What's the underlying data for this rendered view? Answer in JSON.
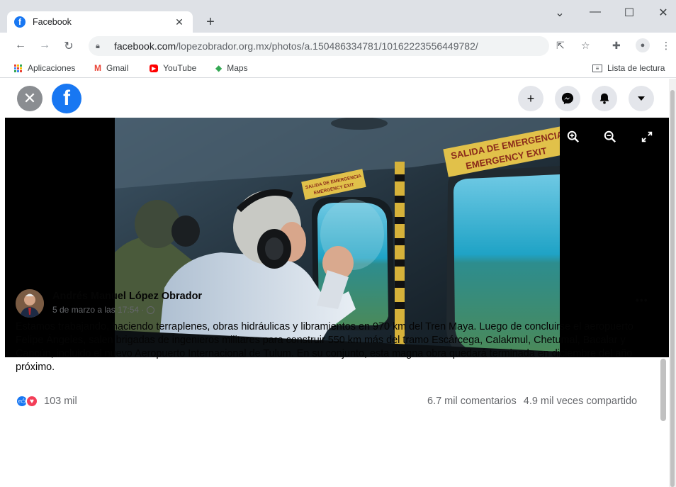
{
  "browser": {
    "tab_title": "Facebook",
    "tab_close": "✕",
    "new_tab": "+",
    "url_domain": "facebook.com",
    "url_path": "/lopezobrador.org.mx/photos/a.150486334781/10162223556449782/",
    "bookmarks": [
      {
        "label": "Aplicaciones"
      },
      {
        "label": "Gmail",
        "icon": "M"
      },
      {
        "label": "YouTube",
        "icon": "▶"
      },
      {
        "label": "Maps",
        "icon": "◆"
      }
    ],
    "reading_list": "Lista de lectura",
    "colors": {
      "tabbar": "#dee1e6",
      "omnibox": "#f1f3f4"
    }
  },
  "viewer": {
    "close_icon": "✕",
    "fb_logo": "f",
    "top_actions": [
      {
        "icon": "+",
        "name": "create"
      },
      {
        "icon": "messenger",
        "name": "messenger"
      },
      {
        "icon": "bell",
        "name": "notifications"
      },
      {
        "icon": "▼",
        "name": "account"
      }
    ],
    "photo_tools": [
      "zoom-in",
      "zoom-out",
      "fullscreen"
    ],
    "sign_texts": [
      "SALIDA DE EMERGENCIA",
      "EMERGENCY EXIT"
    ]
  },
  "post": {
    "author": "Andrés Manuel López Obrador",
    "date": "5 de marzo a las 17:54 ·",
    "more": "•••",
    "caption": "Estamos trabajando, haciendo terraplenes, obras hidráulicas y libramientos en 970 km del Tren Maya. Luego de concluirse el aeropuerto Felipe Ángeles, salen brigadas de ingenieros militares para construir 550 km más del tramo Escárcega, Calakmul, Chetumal, Bacalar y Cancún, incluido el nuevo Aeropuerto Internacional de Tulum. En su conjunto, esta magna obra quedará terminada en diciembre del año próximo.",
    "reactions_count": "103 mil",
    "comments": "6.7 mil comentarios",
    "shares": "4.9 mil veces compartido"
  },
  "colors": {
    "facebook_blue": "#1877f2",
    "love_red": "#f33e58",
    "meta_gray": "#65676b"
  }
}
